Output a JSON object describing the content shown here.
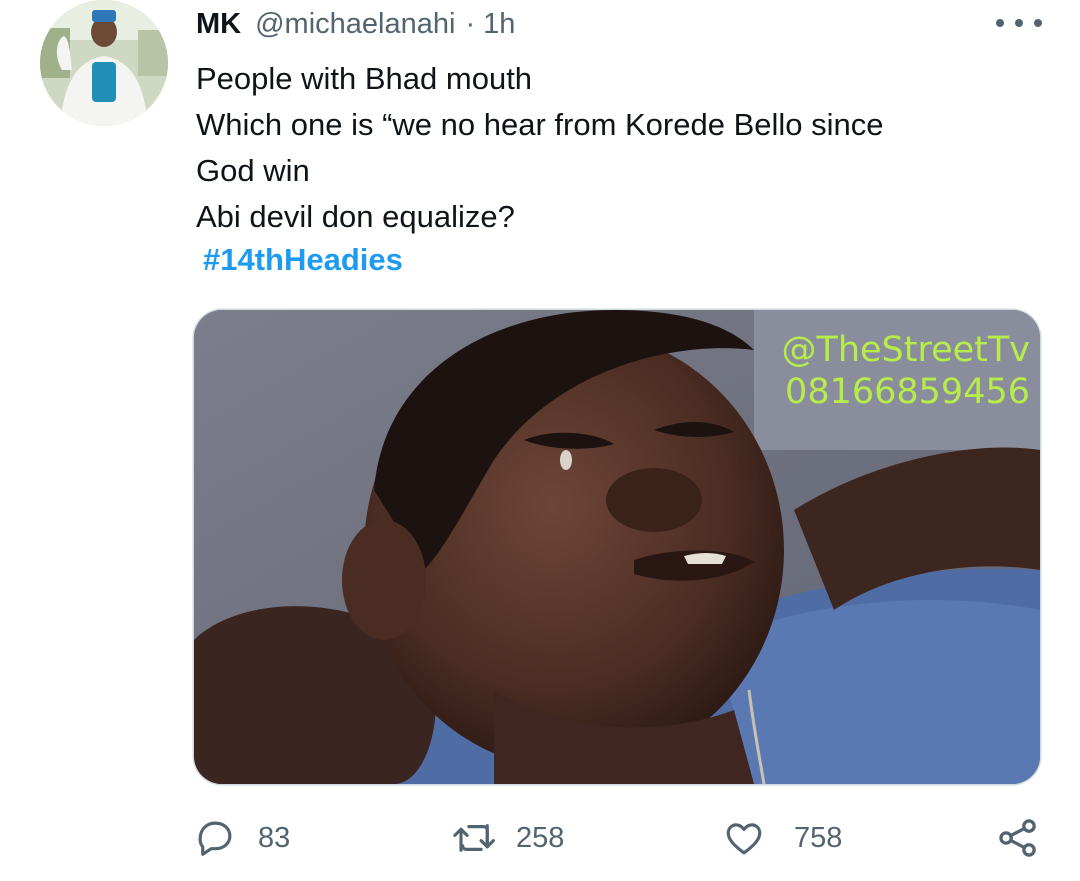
{
  "tweet": {
    "author_name": "MK",
    "author_handle": "@michaelanahi",
    "separator": "·",
    "time": "1h",
    "lines": [
      "People with Bhad mouth",
      "Which one is “we no hear from Korede Bello since",
      "God win",
      "Abi devil don equalize?"
    ],
    "hashtag": "#14thHeadies",
    "media": {
      "watermark_handle": "@TheStreetTv",
      "watermark_phone": "08166859456"
    }
  },
  "actions": {
    "reply_count": "83",
    "retweet_count": "258",
    "like_count": "758"
  },
  "icons": {
    "reply": "reply-icon",
    "retweet": "retweet-icon",
    "like": "like-icon",
    "share": "share-icon",
    "more": "more-icon"
  },
  "colors": {
    "link": "#1d9bf0",
    "muted": "#536471",
    "watermark": "#b7ec4a"
  }
}
